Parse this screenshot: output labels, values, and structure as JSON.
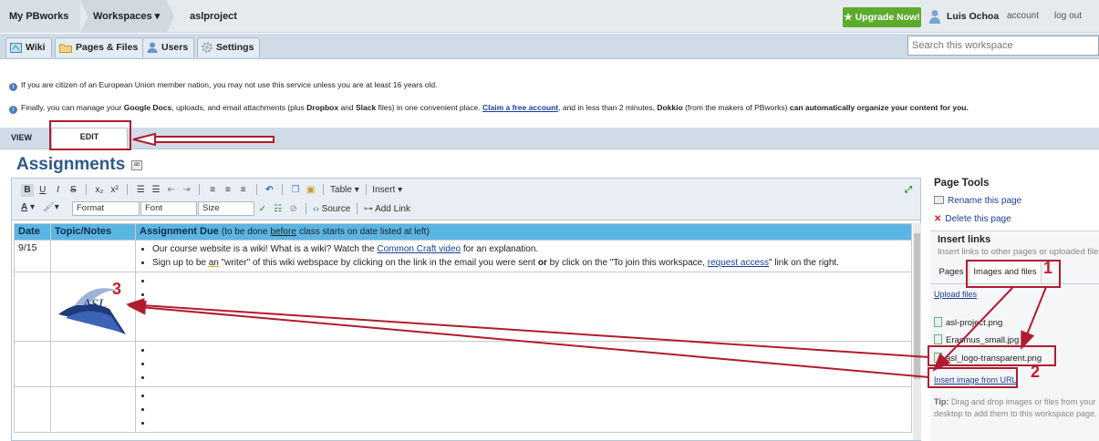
{
  "topbar": {
    "home": "My PBworks",
    "workspaces": "Workspaces ▾",
    "project": "aslproject",
    "upgrade": "Upgrade Now!",
    "user": "Luis Ochoa",
    "account": "account",
    "logout": "log out"
  },
  "nav_tabs": [
    "Wiki",
    "Pages & Files",
    "Users",
    "Settings"
  ],
  "search": {
    "placeholder": "Search this workspace"
  },
  "notices": {
    "age_notice": "If you are citizen of an European Union member nation, you may not use this service unless you are at least 16 years old.",
    "promo_1": "Finally, you can manage your",
    "promo_google_docs": "Google Docs",
    "promo_2": ", uploads, and email attachments (plus",
    "promo_dropbox": "Dropbox",
    "promo_3": "and",
    "promo_slack": "Slack",
    "promo_4": "files) in one convenient place.",
    "promo_claim": "Claim a free account",
    "promo_5": ", and in less than 2 minutes,",
    "promo_dokkio": "Dokkio",
    "promo_6": "(from the makers of PBworks)",
    "promo_7": "can automatically organize your content for you."
  },
  "view_tab": "VIEW",
  "edit_tab": "EDIT",
  "page_title": "Assignments",
  "toolbar": {
    "format": "Format",
    "font": "Font",
    "size": "Size",
    "table": "Table ▾",
    "insert": "Insert ▾",
    "source": "Source",
    "add_link": "Add Link"
  },
  "table": {
    "headers": {
      "date": "Date",
      "topic": "Topic/Notes",
      "assignment": "Assignment Due",
      "assignment_note_1": "(to be done",
      "assignment_note_before": "before",
      "assignment_note_2": "class starts on date listed at left)"
    },
    "row1": {
      "date": "9/15",
      "bullet1_a": "Our course website is a wiki! What is a wiki? Watch the",
      "bullet1_link": "Common Craft video",
      "bullet1_b": "for an explanation.",
      "bullet2_a": "Sign up to be",
      "bullet2_an": "an",
      "bullet2_b": "\"writer\" of this wiki webspace by clicking on the link in the email you were sent",
      "bullet2_or": "or",
      "bullet2_c": "by click on the \"To join this workspace,",
      "bullet2_link": "request access",
      "bullet2_d": "\" link on the right."
    },
    "logo_text": "ASL"
  },
  "page_tools": {
    "title": "Page Tools",
    "rename": "Rename this page",
    "delete": "Delete this page"
  },
  "insert_links": {
    "title": "Insert links",
    "subtitle": "Insert links to other pages or uploaded files.",
    "tab_pages": "Pages",
    "tab_images": "Images and files",
    "upload": "Upload files",
    "files": [
      "asl-project.png",
      "Erasmus_small.jpg",
      "asl_logo-transparent.png"
    ],
    "insert_url": "Insert image from URL",
    "tip_label": "Tip:",
    "tip_text": "Drag and drop images or files from your desktop to add them to this workspace page."
  },
  "annotations": {
    "num1": "1",
    "num2": "2",
    "num3": "3",
    "color": "#b01c2e"
  }
}
